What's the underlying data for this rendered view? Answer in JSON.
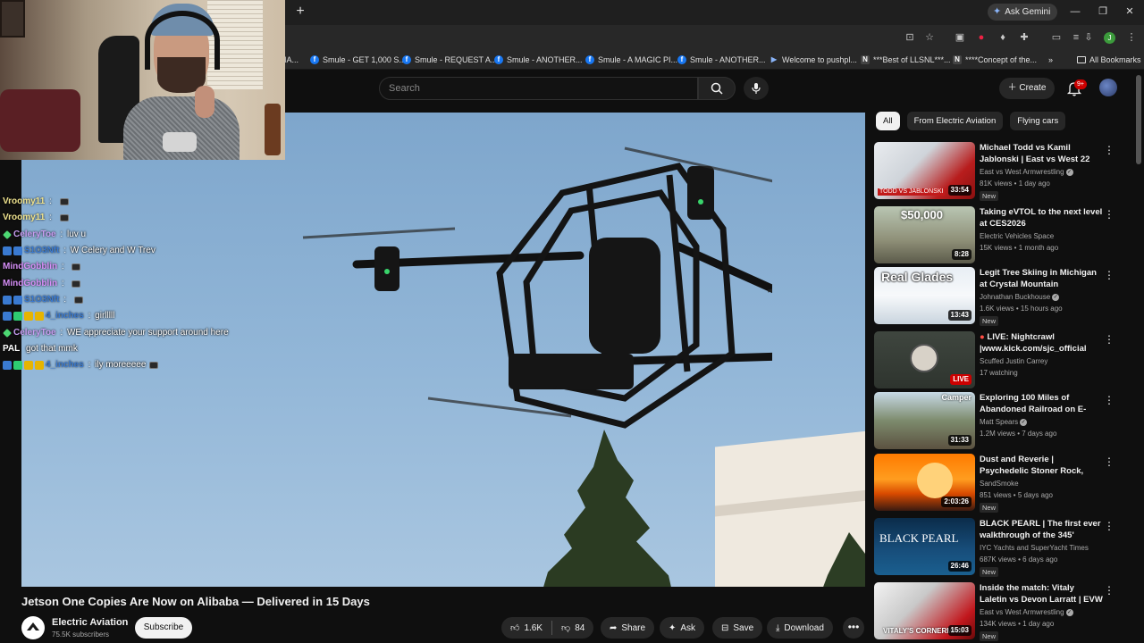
{
  "browser": {
    "new_tab_label": "+",
    "ask_gemini_label": "Ask Gemini",
    "window_controls": [
      "—",
      "❐",
      "✕"
    ],
    "profile_initial": "J",
    "bookmarks": [
      {
        "label": "IA...",
        "icon": "partial-tab"
      },
      {
        "label": "Smule - GET 1,000 S...",
        "icon": "facebook-icon"
      },
      {
        "label": "Smule - REQUEST A...",
        "icon": "facebook-icon"
      },
      {
        "label": "Smule - ANOTHER...",
        "icon": "facebook-icon"
      },
      {
        "label": "Smule - A MAGIC PI...",
        "icon": "facebook-icon"
      },
      {
        "label": "Smule - ANOTHER...",
        "icon": "facebook-icon"
      },
      {
        "label": "Welcome to pushpl...",
        "icon": "pushplay-icon"
      },
      {
        "label": "***Best of LLSNL***...",
        "icon": "doc-icon"
      },
      {
        "label": "****Concept of the...",
        "icon": "doc-icon"
      },
      {
        "label": "»",
        "icon": "chevron-icon"
      },
      {
        "label": "All Bookmarks",
        "icon": "folder-icon"
      }
    ]
  },
  "masthead": {
    "search_placeholder": "Search",
    "create_label": "Create",
    "notification_badge": "9+"
  },
  "chat": [
    {
      "user": "Vroomy11",
      "sep": " : ",
      "msg": "",
      "emote": true,
      "badges": [],
      "user_class": "u-vroomy"
    },
    {
      "user": "Vroomy11",
      "sep": " : ",
      "msg": "",
      "emote": true,
      "badges": [],
      "user_class": "u-vroomy"
    },
    {
      "user": "CeleryToe",
      "sep": " : ",
      "msg": "luv u",
      "emote": false,
      "badges": [
        "green-diamond"
      ],
      "user_class": "u-celery-name"
    },
    {
      "user": "S1O3Nft",
      "sep": " : ",
      "msg": "W Celery and W Trev",
      "emote": false,
      "badges": [
        "blue",
        "blue"
      ],
      "user_class": "u-s1"
    },
    {
      "user": "MindGobblin",
      "sep": " : ",
      "msg": "",
      "emote": true,
      "badges": [],
      "user_class": "u-mind"
    },
    {
      "user": "MindGobblin",
      "sep": " : ",
      "msg": "",
      "emote": true,
      "badges": [],
      "user_class": "u-mind"
    },
    {
      "user": "S1O3Nft",
      "sep": " : ",
      "msg": "",
      "emote": true,
      "badges": [
        "blue",
        "blue"
      ],
      "user_class": "u-s1"
    },
    {
      "user": "4_inches",
      "sep": " : ",
      "msg": "girlllll",
      "emote": false,
      "badges": [
        "blue",
        "green",
        "gold",
        "gold"
      ],
      "user_class": "u-4in"
    },
    {
      "user": "CeleryToe",
      "sep": " : ",
      "msg": "WE appreciate your support around here",
      "emote": false,
      "badges": [
        "green-diamond"
      ],
      "user_class": "u-celery-name"
    },
    {
      "user": "PAL",
      "sep": " ",
      "msg": "got that mmk",
      "emote": false,
      "badges": [],
      "user_class": "u-pal"
    },
    {
      "user": "4_inches",
      "sep": " : ",
      "msg": "ily moreeeee",
      "emote": true,
      "badges": [
        "blue",
        "green",
        "gold",
        "gold"
      ],
      "user_class": "u-4in"
    }
  ],
  "video": {
    "title": "Jetson One Copies Are Now on Alibaba — Delivered in 15 Days",
    "channel_name": "Electric Aviation",
    "channel_subs": "75.5K subscribers",
    "subscribe_label": "Subscribe",
    "likes": "1.6K",
    "dislikes": "84",
    "share_label": "Share",
    "ask_label": "Ask",
    "save_label": "Save",
    "download_label": "Download",
    "more_label": "•••"
  },
  "chips": [
    {
      "label": "All",
      "active": true
    },
    {
      "label": "From Electric Aviation",
      "active": false
    },
    {
      "label": "Flying cars",
      "active": false
    }
  ],
  "recommendations": [
    {
      "title": "Michael Todd vs Kamil Jablonski | East vs West 22 Fu...",
      "channel": "East vs West Armwrestling",
      "verified": true,
      "meta": "81K views • 1 day ago",
      "badge": "New",
      "duration": "33:54",
      "live": false,
      "thumb_text": "TODD VS JABLONSKI",
      "thumb": "armwrestle"
    },
    {
      "title": "Taking eVTOL to the next level at CES2026",
      "channel": "Electric Vehicles Space",
      "verified": false,
      "meta": "15K views • 1 month ago",
      "badge": "",
      "duration": "8:28",
      "live": false,
      "thumb_text": "$50,000",
      "thumb": "evtol"
    },
    {
      "title": "Legit Tree Skiing in Michigan at Crystal Mountain",
      "channel": "Johnathan Buckhouse",
      "verified": true,
      "meta": "1.6K views • 15 hours ago",
      "badge": "New",
      "duration": "13:43",
      "live": false,
      "thumb_text": "Real Glades",
      "thumb": "ski"
    },
    {
      "title": "LIVE: Nightcrawl |www.kick.com/sjc_official",
      "channel": "Scuffed Justin Carrey",
      "verified": false,
      "meta": "17 watching",
      "badge": "",
      "duration": "LIVE",
      "live": true,
      "thumb_text": "",
      "thumb": "live"
    },
    {
      "title": "Exploring 100 Miles of Abandoned Railroad on E-Bike...",
      "channel": "Matt Spears",
      "verified": true,
      "meta": "1.2M views • 7 days ago",
      "badge": "",
      "duration": "31:33",
      "live": false,
      "thumb_text": "Camper",
      "thumb": "rail"
    },
    {
      "title": "Dust and Reverie | Psychedelic Stoner Rock, Doom Metal Mix",
      "channel": "SandSmoke",
      "verified": false,
      "meta": "851 views • 5 days ago",
      "badge": "New",
      "duration": "2:03:26",
      "live": false,
      "thumb_text": "",
      "thumb": "sunset"
    },
    {
      "title": "BLACK PEARL | The first ever walkthrough of the 345' (105m...",
      "channel": "IYC Yachts and SuperYacht Times",
      "verified": false,
      "meta": "687K views • 6 days ago",
      "badge": "New",
      "duration": "26:46",
      "live": false,
      "thumb_text": "BLACK PEARL",
      "thumb": "yacht"
    },
    {
      "title": "Inside the match: Vitaly Laletin vs Devon Larratt | EVW 22",
      "channel": "East vs West Armwrestling",
      "verified": true,
      "meta": "134K views • 1 day ago",
      "badge": "New",
      "duration": "15:03",
      "live": false,
      "thumb_text": "VITALY'S CORNERMAN",
      "thumb": "armwrestle2"
    }
  ],
  "colors": {
    "bg": "#0f0f0f",
    "pill": "#272727",
    "live_red": "#cc0000",
    "text_secondary": "#aaaaaa"
  }
}
